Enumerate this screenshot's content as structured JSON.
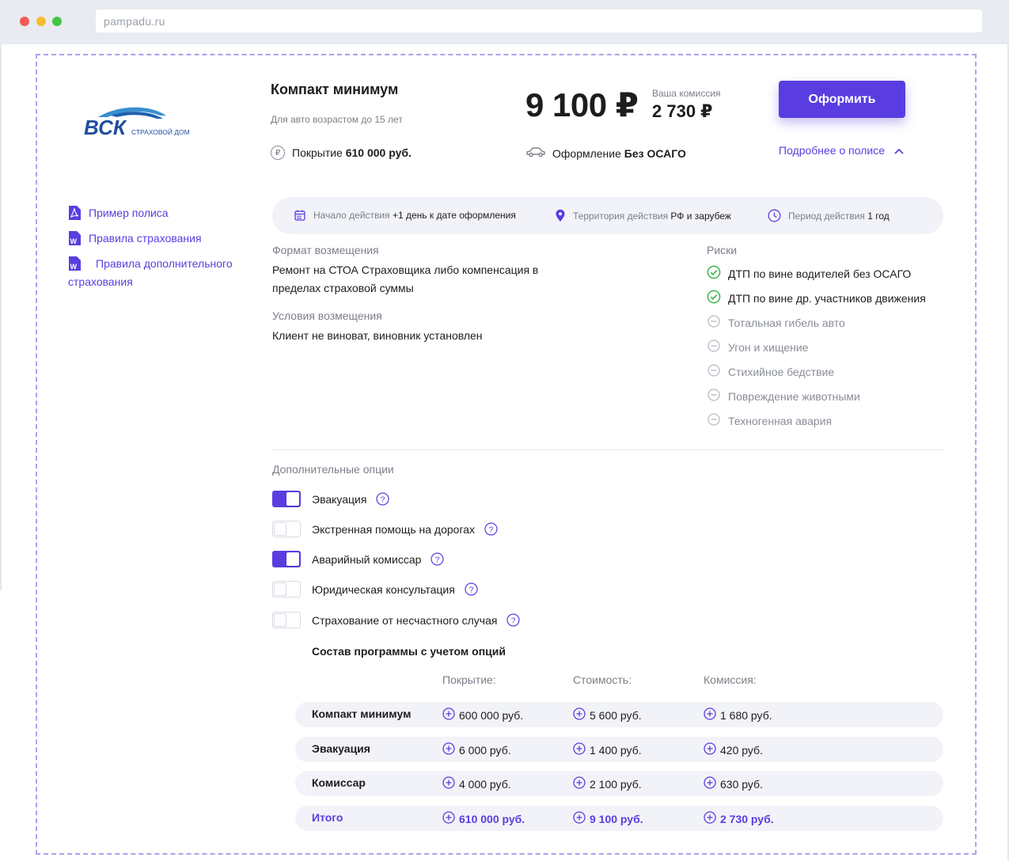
{
  "browser": {
    "url": "pampadu.ru"
  },
  "header": {
    "plan_title": "Компакт минимум",
    "plan_subtitle": "Для авто возрастом до 15 лет",
    "coverage_label": "Покрытие",
    "coverage_value": "610 000 руб.",
    "price": "9 100 ₽",
    "commission_label": "Ваша комиссия",
    "commission_value": "2 730 ₽",
    "issue_label": "Оформление",
    "issue_value": "Без ОСАГО",
    "submit_label": "Оформить",
    "more_label": "Подробнее о полисе"
  },
  "docs": [
    {
      "label": "Пример полиса",
      "icon": "pdf-file-icon"
    },
    {
      "label": "Правила страхования",
      "icon": "word-file-icon"
    },
    {
      "label": "Правила дополнительного страхования",
      "icon": "word-file-icon"
    }
  ],
  "info": {
    "start_label": "Начало действия",
    "start_value": "+1 день к дате оформления",
    "territory_label": "Территория действия",
    "territory_value": "РФ и зарубеж",
    "period_label": "Период действия",
    "period_value": "1 год"
  },
  "reimbursement": {
    "format_label": "Формат возмещения",
    "format_text": "Ремонт на СТОА Страховщика либо компенсация в пределах страховой суммы",
    "conditions_label": "Условия возмещения",
    "conditions_text": "Клиент не виноват, виновник установлен"
  },
  "risks": {
    "label": "Риски",
    "items": [
      {
        "label": "ДТП по вине водителей без ОСАГО",
        "included": true
      },
      {
        "label": "ДТП по вине др. участников движения",
        "included": true
      },
      {
        "label": "Тотальная гибель авто",
        "included": false
      },
      {
        "label": "Угон и хищение",
        "included": false
      },
      {
        "label": "Стихийное бедствие",
        "included": false
      },
      {
        "label": "Повреждение животными",
        "included": false
      },
      {
        "label": "Техногенная авария",
        "included": false
      }
    ]
  },
  "options": {
    "label": "Дополнительные опции",
    "items": [
      {
        "label": "Эвакуация",
        "enabled": true
      },
      {
        "label": "Экстренная помощь на дорогах",
        "enabled": false
      },
      {
        "label": "Аварийный комиссар",
        "enabled": true
      },
      {
        "label": "Юридическая консультация",
        "enabled": false
      },
      {
        "label": "Страхование от несчастного случая",
        "enabled": false
      }
    ]
  },
  "composition": {
    "title": "Состав программы с учетом опций",
    "headers": [
      "Покрытие:",
      "Стоимость:",
      "Комиссия:"
    ],
    "rows": [
      {
        "name": "Компакт минимум",
        "coverage": "600 000 руб.",
        "cost": "5 600 руб.",
        "commission": "1 680 руб."
      },
      {
        "name": "Эвакуация",
        "coverage": "6 000 руб.",
        "cost": "1 400 руб.",
        "commission": "420 руб."
      },
      {
        "name": "Комиссар",
        "coverage": "4 000 руб.",
        "cost": "2 100 руб.",
        "commission": "630 руб."
      },
      {
        "name": "Итого",
        "coverage": "610 000 руб.",
        "cost": "9 100 руб.",
        "commission": "2 730 руб."
      }
    ]
  },
  "colors": {
    "accent": "#5a3de0",
    "success": "#3bb54a",
    "muted": "#8a8e97",
    "dashed_border": "#a9a4ef"
  },
  "logo": {
    "text": "ВСК",
    "subtitle": "СТРАХОВОЙ ДОМ"
  }
}
